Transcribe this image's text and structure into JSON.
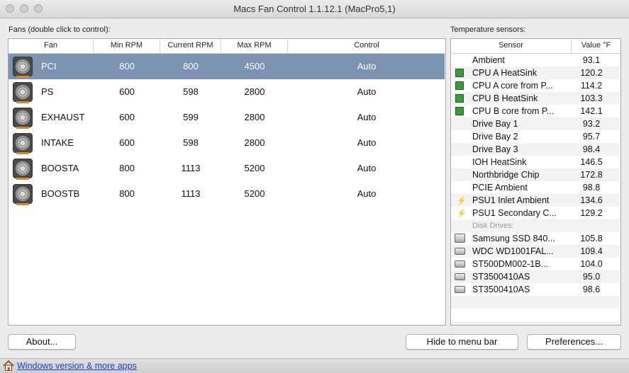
{
  "window": {
    "title": "Macs Fan Control 1.1.12.1 (MacPro5,1)"
  },
  "fans_panel": {
    "label": "Fans (double click to control):",
    "columns": {
      "fan": "Fan",
      "min": "Min RPM",
      "current": "Current RPM",
      "max": "Max RPM",
      "control": "Control"
    },
    "rows": [
      {
        "name": "PCI",
        "min": "800",
        "current": "800",
        "max": "4500",
        "control": "Auto",
        "selected": true
      },
      {
        "name": "PS",
        "min": "600",
        "current": "598",
        "max": "2800",
        "control": "Auto"
      },
      {
        "name": "EXHAUST",
        "min": "600",
        "current": "599",
        "max": "2800",
        "control": "Auto"
      },
      {
        "name": "INTAKE",
        "min": "600",
        "current": "598",
        "max": "2800",
        "control": "Auto"
      },
      {
        "name": "BOOSTA",
        "min": "800",
        "current": "1113",
        "max": "5200",
        "control": "Auto"
      },
      {
        "name": "BOOSTB",
        "min": "800",
        "current": "1113",
        "max": "5200",
        "control": "Auto"
      }
    ]
  },
  "sensors_panel": {
    "label": "Temperature sensors:",
    "columns": {
      "sensor": "Sensor",
      "value": "Value °F"
    },
    "rows": [
      {
        "name": "Ambient",
        "value": "93.1",
        "icon": "none"
      },
      {
        "name": "CPU A HeatSink",
        "value": "120.2",
        "icon": "chip"
      },
      {
        "name": "CPU A core from P...",
        "value": "114.2",
        "icon": "chip"
      },
      {
        "name": "CPU B HeatSink",
        "value": "103.3",
        "icon": "chip"
      },
      {
        "name": "CPU B core from P...",
        "value": "142.1",
        "icon": "chip"
      },
      {
        "name": "Drive Bay 1",
        "value": "93.2",
        "icon": "none"
      },
      {
        "name": "Drive Bay 2",
        "value": "95.7",
        "icon": "none"
      },
      {
        "name": "Drive Bay 3",
        "value": "98.4",
        "icon": "none"
      },
      {
        "name": "IOH HeatSink",
        "value": "146.5",
        "icon": "none"
      },
      {
        "name": "Northbridge Chip",
        "value": "172.8",
        "icon": "none"
      },
      {
        "name": "PCIE Ambient",
        "value": "98.8",
        "icon": "none"
      },
      {
        "name": "PSU1 Inlet Ambient",
        "value": "134.6",
        "icon": "bolt"
      },
      {
        "name": "PSU1 Secondary C...",
        "value": "129.2",
        "icon": "bolt"
      }
    ],
    "disk_group_label": "Disk Drives:",
    "disks": [
      {
        "name": "Samsung SSD 840...",
        "value": "105.8",
        "icon": "ssd"
      },
      {
        "name": "WDC WD1001FAL...",
        "value": "109.4",
        "icon": "hdd"
      },
      {
        "name": "ST500DM002-1B...",
        "value": "104.0",
        "icon": "hdd"
      },
      {
        "name": "ST3500410AS",
        "value": "95.0",
        "icon": "hdd"
      },
      {
        "name": "ST3500410AS",
        "value": "98.6",
        "icon": "hdd"
      }
    ]
  },
  "buttons": {
    "about": "About...",
    "hide": "Hide to menu bar",
    "preferences": "Preferences..."
  },
  "status": {
    "link": "Windows version & more apps",
    "icon": "home-icon"
  },
  "colors": {
    "selection": "#7b93b1",
    "link": "#1a3ed8",
    "chip": "#3d9a3d"
  }
}
